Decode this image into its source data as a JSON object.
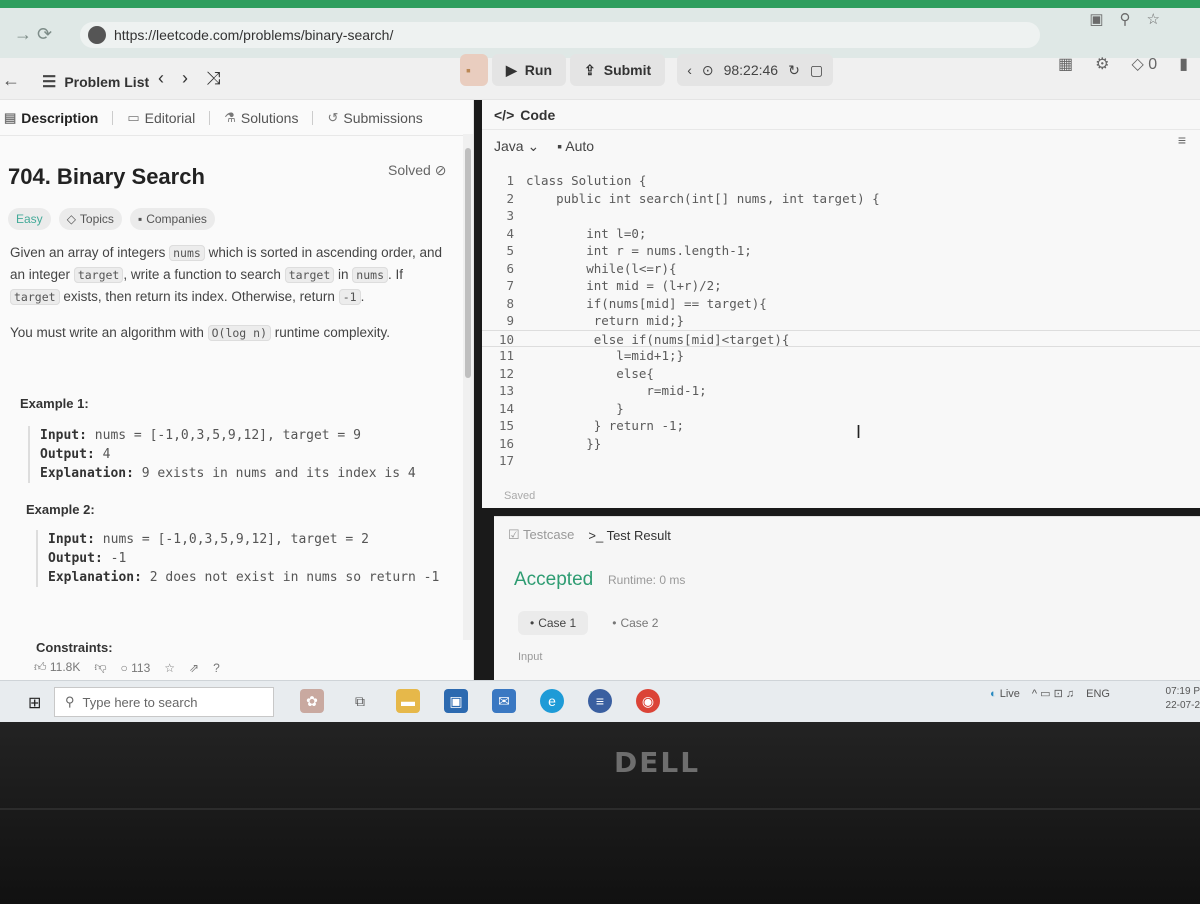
{
  "browser": {
    "url": "https://leetcode.com/problems/binary-search/"
  },
  "topbar": {
    "problem_list": "Problem List",
    "run": "Run",
    "submit": "Submit",
    "timer": "98:22:46",
    "coins": "0"
  },
  "tabs": {
    "description": "Description",
    "editorial": "Editorial",
    "solutions": "Solutions",
    "submissions": "Submissions"
  },
  "problem": {
    "title": "704. Binary Search",
    "status": "Solved",
    "difficulty": "Easy",
    "topics": "Topics",
    "companies": "Companies",
    "desc_1": "Given an array of integers",
    "desc_nums": "nums",
    "desc_2": "which is sorted in ascending order, and an integer",
    "desc_target": "target",
    "desc_3": ", write a function to search",
    "desc_4": "in",
    "desc_5": ". If",
    "desc_6": "exists, then return its index. Otherwise, return",
    "desc_neg1": "-1",
    "desc_7": ".",
    "complexity_1": "You must write an algorithm with",
    "complexity_code": "O(log n)",
    "complexity_2": "runtime complexity.",
    "example1_title": "Example 1:",
    "example1_input_label": "Input:",
    "example1_input": "nums = [-1,0,3,5,9,12], target = 9",
    "example1_output_label": "Output:",
    "example1_output": "4",
    "example1_expl_label": "Explanation:",
    "example1_expl": "9 exists in nums and its index is 4",
    "example2_title": "Example 2:",
    "example2_input_label": "Input:",
    "example2_input": "nums = [-1,0,3,5,9,12], target = 2",
    "example2_output_label": "Output:",
    "example2_output": "-1",
    "example2_expl_label": "Explanation:",
    "example2_expl": "2 does not exist in nums so return -1",
    "constraints_title": "Constraints:",
    "likes": "11.8K",
    "comments": "113"
  },
  "editor": {
    "header": "Code",
    "language": "Java",
    "mode": "Auto",
    "saved": "Saved",
    "lines": [
      {
        "n": "1",
        "t": "class Solution {"
      },
      {
        "n": "2",
        "t": "    public int search(int[] nums, int target) {"
      },
      {
        "n": "3",
        "t": ""
      },
      {
        "n": "4",
        "t": "        int l=0;"
      },
      {
        "n": "5",
        "t": "        int r = nums.length-1;"
      },
      {
        "n": "6",
        "t": "        while(l<=r){"
      },
      {
        "n": "7",
        "t": "        int mid = (l+r)/2;"
      },
      {
        "n": "8",
        "t": "        if(nums[mid] == target){"
      },
      {
        "n": "9",
        "t": "         return mid;}"
      },
      {
        "n": "10",
        "t": "         else if(nums[mid]<target){"
      },
      {
        "n": "11",
        "t": "            l=mid+1;}"
      },
      {
        "n": "12",
        "t": "            else{"
      },
      {
        "n": "13",
        "t": "                r=mid-1;"
      },
      {
        "n": "14",
        "t": "            }"
      },
      {
        "n": "15",
        "t": "         } return -1;"
      },
      {
        "n": "16",
        "t": "        }}"
      },
      {
        "n": "17",
        "t": ""
      }
    ]
  },
  "result": {
    "testcase_tab": "Testcase",
    "result_tab": "Test Result",
    "verdict": "Accepted",
    "runtime": "Runtime: 0 ms",
    "case1": "Case 1",
    "case2": "Case 2",
    "input_label": "Input"
  },
  "taskbar": {
    "search_placeholder": "Type here to search",
    "weather": "Live",
    "lang": "ENG",
    "time": "07:19 P",
    "date": "22-07-2"
  },
  "bezel": {
    "brand": "DELL"
  }
}
